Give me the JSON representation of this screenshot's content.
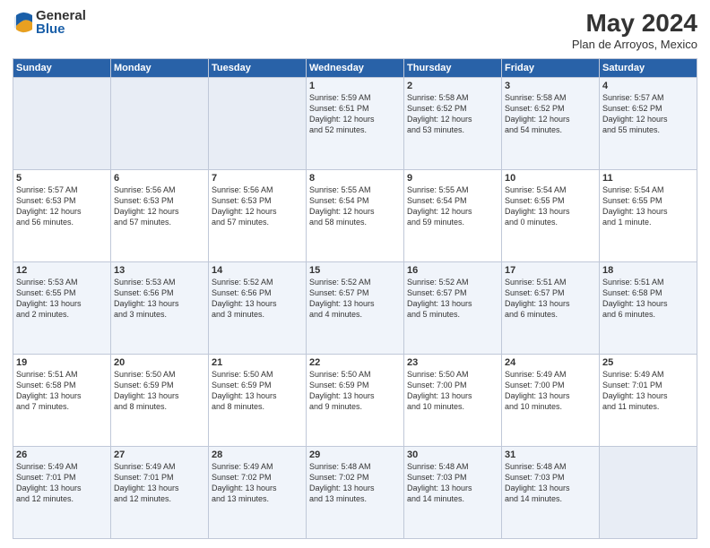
{
  "logo": {
    "general": "General",
    "blue": "Blue"
  },
  "header": {
    "title": "May 2024",
    "subtitle": "Plan de Arroyos, Mexico"
  },
  "weekdays": [
    "Sunday",
    "Monday",
    "Tuesday",
    "Wednesday",
    "Thursday",
    "Friday",
    "Saturday"
  ],
  "weeks": [
    [
      {
        "day": "",
        "info": ""
      },
      {
        "day": "",
        "info": ""
      },
      {
        "day": "",
        "info": ""
      },
      {
        "day": "1",
        "info": "Sunrise: 5:59 AM\nSunset: 6:51 PM\nDaylight: 12 hours\nand 52 minutes."
      },
      {
        "day": "2",
        "info": "Sunrise: 5:58 AM\nSunset: 6:52 PM\nDaylight: 12 hours\nand 53 minutes."
      },
      {
        "day": "3",
        "info": "Sunrise: 5:58 AM\nSunset: 6:52 PM\nDaylight: 12 hours\nand 54 minutes."
      },
      {
        "day": "4",
        "info": "Sunrise: 5:57 AM\nSunset: 6:52 PM\nDaylight: 12 hours\nand 55 minutes."
      }
    ],
    [
      {
        "day": "5",
        "info": "Sunrise: 5:57 AM\nSunset: 6:53 PM\nDaylight: 12 hours\nand 56 minutes."
      },
      {
        "day": "6",
        "info": "Sunrise: 5:56 AM\nSunset: 6:53 PM\nDaylight: 12 hours\nand 57 minutes."
      },
      {
        "day": "7",
        "info": "Sunrise: 5:56 AM\nSunset: 6:53 PM\nDaylight: 12 hours\nand 57 minutes."
      },
      {
        "day": "8",
        "info": "Sunrise: 5:55 AM\nSunset: 6:54 PM\nDaylight: 12 hours\nand 58 minutes."
      },
      {
        "day": "9",
        "info": "Sunrise: 5:55 AM\nSunset: 6:54 PM\nDaylight: 12 hours\nand 59 minutes."
      },
      {
        "day": "10",
        "info": "Sunrise: 5:54 AM\nSunset: 6:55 PM\nDaylight: 13 hours\nand 0 minutes."
      },
      {
        "day": "11",
        "info": "Sunrise: 5:54 AM\nSunset: 6:55 PM\nDaylight: 13 hours\nand 1 minute."
      }
    ],
    [
      {
        "day": "12",
        "info": "Sunrise: 5:53 AM\nSunset: 6:55 PM\nDaylight: 13 hours\nand 2 minutes."
      },
      {
        "day": "13",
        "info": "Sunrise: 5:53 AM\nSunset: 6:56 PM\nDaylight: 13 hours\nand 3 minutes."
      },
      {
        "day": "14",
        "info": "Sunrise: 5:52 AM\nSunset: 6:56 PM\nDaylight: 13 hours\nand 3 minutes."
      },
      {
        "day": "15",
        "info": "Sunrise: 5:52 AM\nSunset: 6:57 PM\nDaylight: 13 hours\nand 4 minutes."
      },
      {
        "day": "16",
        "info": "Sunrise: 5:52 AM\nSunset: 6:57 PM\nDaylight: 13 hours\nand 5 minutes."
      },
      {
        "day": "17",
        "info": "Sunrise: 5:51 AM\nSunset: 6:57 PM\nDaylight: 13 hours\nand 6 minutes."
      },
      {
        "day": "18",
        "info": "Sunrise: 5:51 AM\nSunset: 6:58 PM\nDaylight: 13 hours\nand 6 minutes."
      }
    ],
    [
      {
        "day": "19",
        "info": "Sunrise: 5:51 AM\nSunset: 6:58 PM\nDaylight: 13 hours\nand 7 minutes."
      },
      {
        "day": "20",
        "info": "Sunrise: 5:50 AM\nSunset: 6:59 PM\nDaylight: 13 hours\nand 8 minutes."
      },
      {
        "day": "21",
        "info": "Sunrise: 5:50 AM\nSunset: 6:59 PM\nDaylight: 13 hours\nand 8 minutes."
      },
      {
        "day": "22",
        "info": "Sunrise: 5:50 AM\nSunset: 6:59 PM\nDaylight: 13 hours\nand 9 minutes."
      },
      {
        "day": "23",
        "info": "Sunrise: 5:50 AM\nSunset: 7:00 PM\nDaylight: 13 hours\nand 10 minutes."
      },
      {
        "day": "24",
        "info": "Sunrise: 5:49 AM\nSunset: 7:00 PM\nDaylight: 13 hours\nand 10 minutes."
      },
      {
        "day": "25",
        "info": "Sunrise: 5:49 AM\nSunset: 7:01 PM\nDaylight: 13 hours\nand 11 minutes."
      }
    ],
    [
      {
        "day": "26",
        "info": "Sunrise: 5:49 AM\nSunset: 7:01 PM\nDaylight: 13 hours\nand 12 minutes."
      },
      {
        "day": "27",
        "info": "Sunrise: 5:49 AM\nSunset: 7:01 PM\nDaylight: 13 hours\nand 12 minutes."
      },
      {
        "day": "28",
        "info": "Sunrise: 5:49 AM\nSunset: 7:02 PM\nDaylight: 13 hours\nand 13 minutes."
      },
      {
        "day": "29",
        "info": "Sunrise: 5:48 AM\nSunset: 7:02 PM\nDaylight: 13 hours\nand 13 minutes."
      },
      {
        "day": "30",
        "info": "Sunrise: 5:48 AM\nSunset: 7:03 PM\nDaylight: 13 hours\nand 14 minutes."
      },
      {
        "day": "31",
        "info": "Sunrise: 5:48 AM\nSunset: 7:03 PM\nDaylight: 13 hours\nand 14 minutes."
      },
      {
        "day": "",
        "info": ""
      }
    ]
  ]
}
